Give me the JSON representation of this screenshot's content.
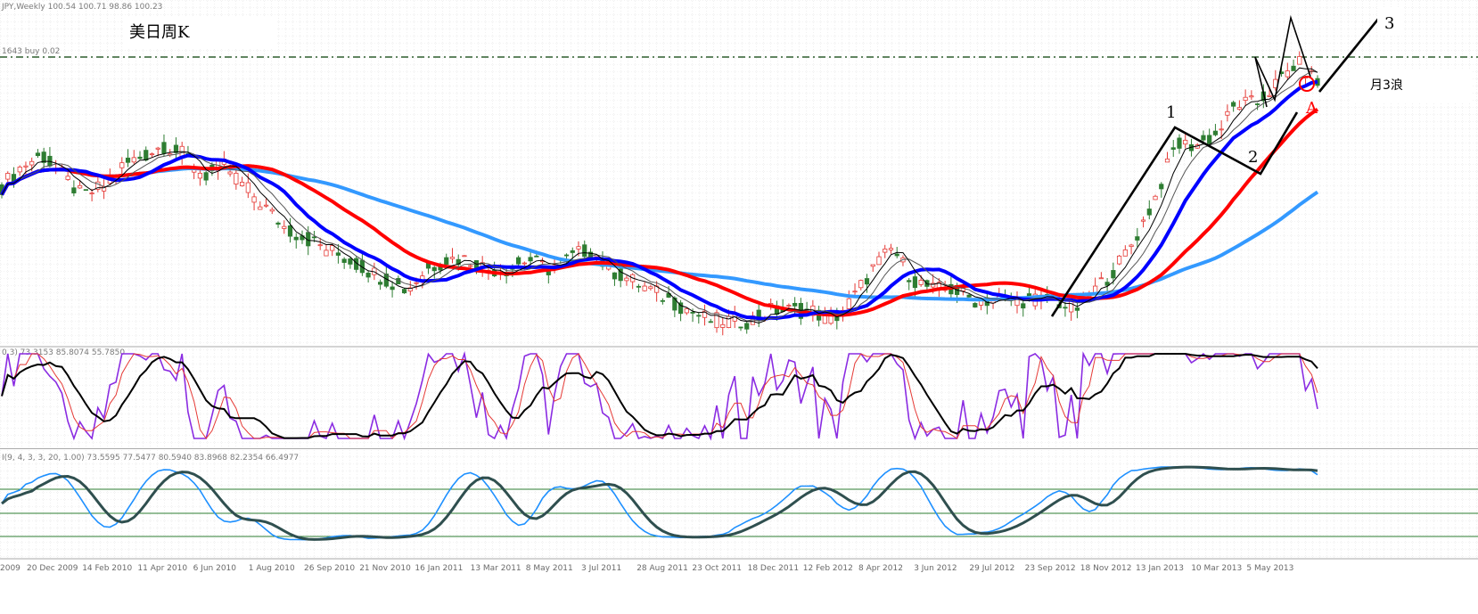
{
  "header": {
    "symbol_line": "JPY,Weekly  100.54 100.71 98.86 100.23",
    "buy_line": "1643 buy 0.02",
    "title": "美日周K"
  },
  "annotations": {
    "wave1": "1",
    "wave2": "2",
    "wave3": "3",
    "note": "月3浪",
    "point_a": "A"
  },
  "indicators": {
    "osc1_label": "0,3) 73.3153 85.8074 55.7850",
    "osc2_label": "I(9, 4, 3, 3, 20, 1.00) 73.5595 77.5477 80.5940 83.8968 82.2354 66.4977"
  },
  "colors": {
    "up_candle": "#e53935",
    "down_candle": "#2e7d32",
    "ma_fast": "#000000",
    "ma_blue": "#0000ff",
    "ma_red": "#ff0000",
    "ma_light_blue": "#3399ff",
    "osc_purple": "#8a2be2",
    "osc2_blue": "#1e90ff",
    "osc2_dark": "#2f4f4f",
    "level_line": "#2e7d32"
  },
  "chart_data": {
    "type": "candlestick",
    "timeframe": "Weekly",
    "x_tick_labels": [
      "2009",
      "20 Dec 2009",
      "14 Feb 2010",
      "11 Apr 2010",
      "6 Jun 2010",
      "1 Aug 2010",
      "26 Sep 2010",
      "21 Nov 2010",
      "16 Jan 2011",
      "13 Mar 2011",
      "8 May 2011",
      "3 Jul 2011",
      "28 Aug 2011",
      "23 Oct 2011",
      "18 Dec 2011",
      "12 Feb 2012",
      "8 Apr 2012",
      "3 Jun 2012",
      "29 Jul 2012",
      "23 Sep 2012",
      "18 Nov 2012",
      "13 Jan 2013",
      "10 Mar 2013",
      "5 May 2013"
    ],
    "last_bar": {
      "open": 100.54,
      "high": 100.71,
      "low": 98.86,
      "close": 100.23
    },
    "price_trend": [
      90,
      92,
      93,
      91,
      89,
      90,
      92,
      93,
      94,
      93,
      91,
      92,
      90,
      88,
      86,
      85,
      84,
      83,
      82,
      81,
      80,
      82,
      83,
      83,
      82,
      82,
      83,
      82,
      83,
      84,
      82,
      81,
      80,
      79,
      78,
      77,
      77,
      77,
      78,
      78,
      78,
      77,
      79,
      82,
      84,
      81,
      80,
      80,
      79,
      79,
      79,
      79,
      79,
      78,
      80,
      82,
      85,
      89,
      94,
      94,
      95,
      98,
      98,
      100,
      102,
      100
    ],
    "series": [
      {
        "name": "",
        "role": "price-candles"
      },
      {
        "name": "",
        "role": "ma-fast-black"
      },
      {
        "name": "",
        "role": "ma-blue"
      },
      {
        "name": "",
        "role": "ma-red"
      },
      {
        "name": "",
        "role": "ma-light-blue"
      }
    ],
    "horizontal_line": "buy 0.02",
    "grid": true,
    "legend": "none"
  }
}
